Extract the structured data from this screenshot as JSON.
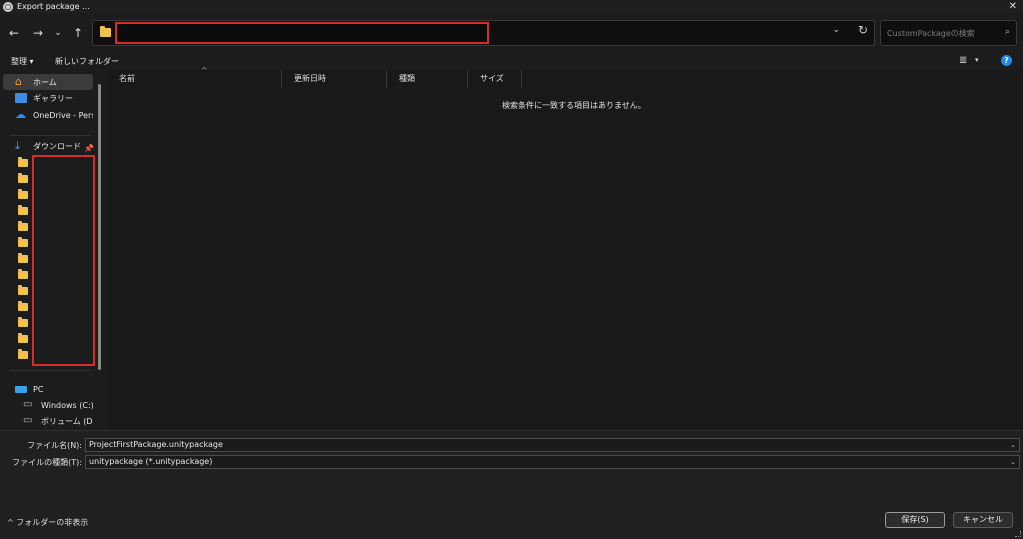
{
  "window": {
    "title": "Export package ...",
    "close_icon": "close-icon"
  },
  "nav": {
    "back": "←",
    "forward": "→",
    "history": "⌄",
    "up": "↑"
  },
  "address": {
    "path": "",
    "dropdown": "⌄",
    "refresh": "↻"
  },
  "search": {
    "placeholder": "CustomPackageの検索"
  },
  "toolbar": {
    "organize": "整理 ▾",
    "new_folder": "新しいフォルダー",
    "view": "≣",
    "view_dd": "▾",
    "help": "?"
  },
  "sidebar": {
    "home": "ホーム",
    "gallery": "ギャラリー",
    "onedrive": "OneDrive - Person",
    "downloads": "ダウンロード",
    "pin": "📌",
    "pc": "PC",
    "windows_c": "Windows (C:)",
    "volume_d": "ボリューム (D:)"
  },
  "columns": {
    "name": "名前",
    "modified": "更新日時",
    "type": "種類",
    "size": "サイズ"
  },
  "empty_message": "検索条件に一致する項目はありません。",
  "form": {
    "filename_label": "ファイル名(N):",
    "filename_value": "ProjectFirstPackage.unitypackage",
    "filetype_label": "ファイルの種類(T):",
    "filetype_value": "unitypackage (*.unitypackage)",
    "dd": "⌄"
  },
  "footer": {
    "toggle_folders": "^ フォルダーの非表示",
    "save": "保存(S)",
    "cancel": "キャンセル"
  }
}
